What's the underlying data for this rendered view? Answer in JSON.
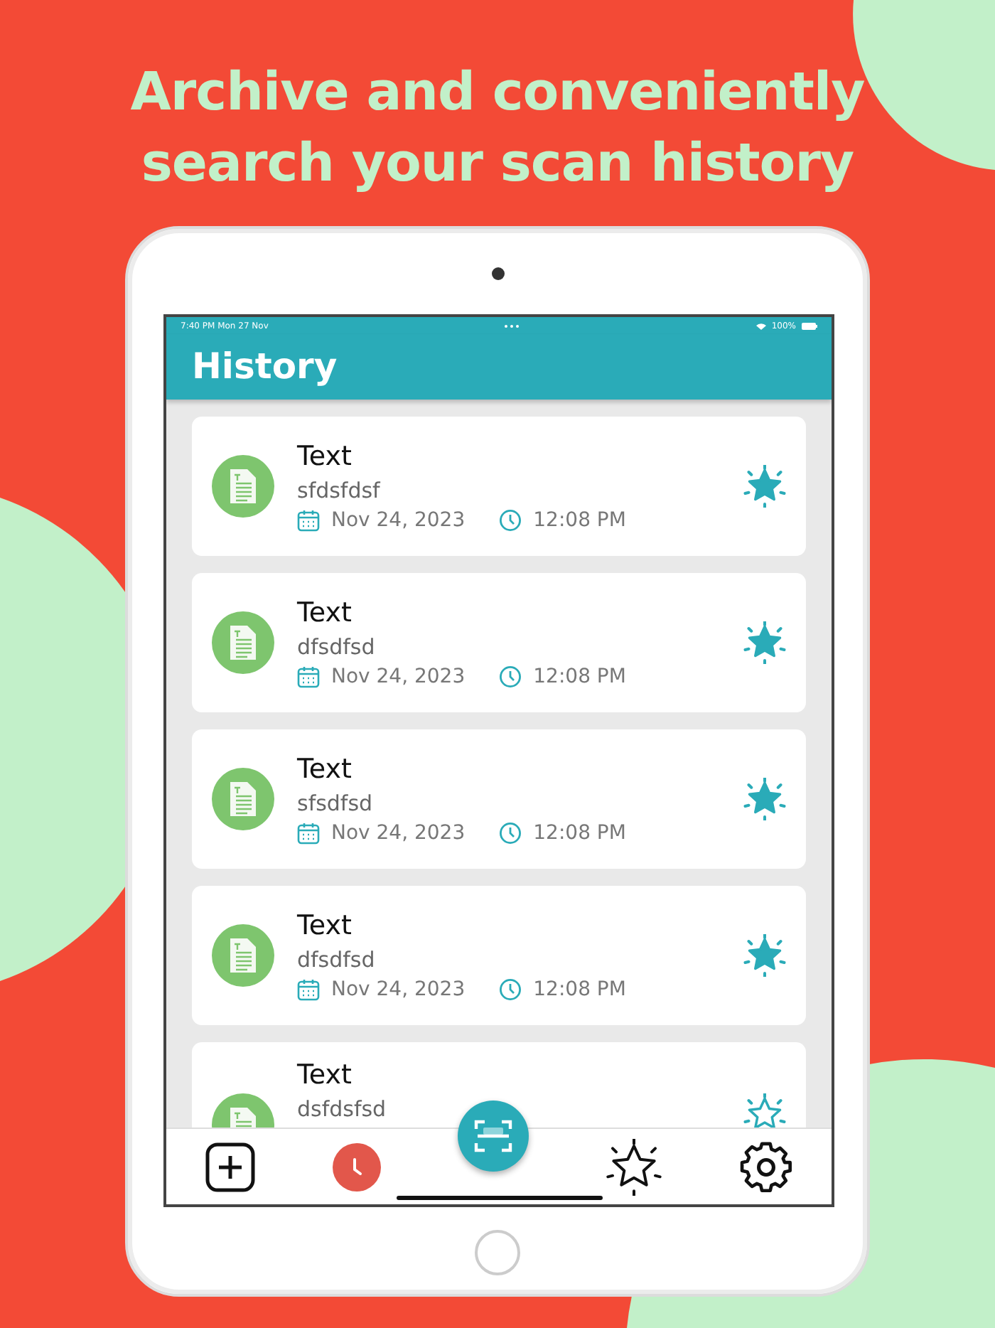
{
  "headline": "Archive and conveniently search your scan history",
  "status_bar": {
    "time": "7:40 PM",
    "date": "Mon 27 Nov",
    "battery": "100%"
  },
  "header": {
    "title": "History"
  },
  "items": [
    {
      "title": "Text",
      "content": "sfdsfdsf",
      "date": "Nov 24, 2023",
      "time": "12:08 PM",
      "favorite": true
    },
    {
      "title": "Text",
      "content": "dfsdfsd",
      "date": "Nov 24, 2023",
      "time": "12:08 PM",
      "favorite": true
    },
    {
      "title": "Text",
      "content": "sfsdfsd",
      "date": "Nov 24, 2023",
      "time": "12:08 PM",
      "favorite": true
    },
    {
      "title": "Text",
      "content": "dfsdfsd",
      "date": "Nov 24, 2023",
      "time": "12:08 PM",
      "favorite": true
    },
    {
      "title": "Text",
      "content": "dsfdsfsd",
      "favorite": false
    }
  ],
  "nav": [
    {
      "kind": "add"
    },
    {
      "kind": "history",
      "selected": true
    },
    {
      "kind": "scan"
    },
    {
      "kind": "favorites",
      "selected": false
    },
    {
      "kind": "settings",
      "selected": false
    }
  ]
}
